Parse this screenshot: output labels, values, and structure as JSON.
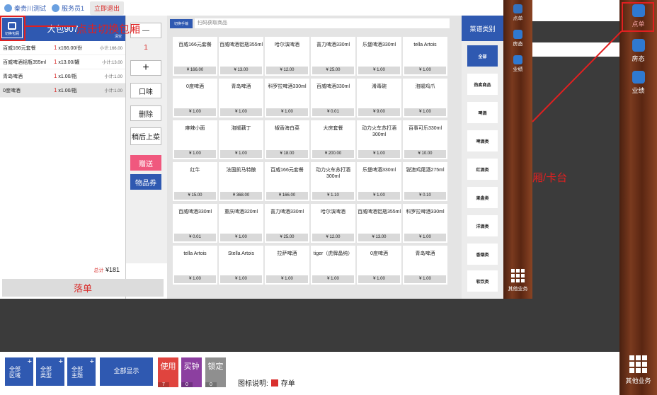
{
  "topbar": {
    "user1": "秦贵川测试",
    "user2": "服务员1",
    "logout": "立即退出"
  },
  "order": {
    "title": "大包907",
    "switch_label": "切换包厢",
    "empty_label": "清空",
    "items": [
      {
        "name": "百威166元套餐",
        "qty": "1",
        "unit": "x166.00/份",
        "sub": "小计:166.00"
      },
      {
        "name": "百威啤酒铝瓶355ml",
        "qty": "1",
        "unit": "x13.00/罐",
        "sub": "小计:13.00"
      },
      {
        "name": "青岛啤酒",
        "qty": "1",
        "unit": "x1.00/瓶",
        "sub": "小计:1.00"
      },
      {
        "name": "0度啤酒",
        "qty": "1",
        "unit": "x1.00/瓶",
        "sub": "小计:1.00"
      }
    ],
    "total_label": "总计",
    "total_value": "¥181",
    "drop_label": "落单"
  },
  "actions": {
    "minus": "—",
    "qty": "1",
    "plus": "+",
    "taste": "口味",
    "delete": "删除",
    "later": "稍后上菜",
    "gift": "赠送",
    "coupon": "物品券"
  },
  "menu": {
    "switch_label": "切换手输",
    "search_placeholder": "扫码获取商品",
    "items": [
      {
        "name": "百威166元套餐",
        "price": "¥ 166.00"
      },
      {
        "name": "百威啤酒铝瓶355ml",
        "price": "¥ 13.00"
      },
      {
        "name": "哈尔滨啤酒",
        "price": "¥ 12.00"
      },
      {
        "name": "喜力啤酒330ml",
        "price": "¥ 25.00"
      },
      {
        "name": "乐堡啤酒330ml",
        "price": "¥ 1.00"
      },
      {
        "name": "tella Artois",
        "price": "¥ 1.00"
      },
      {
        "name": "0度啤酒",
        "price": "¥ 1.00"
      },
      {
        "name": "青岛啤酒",
        "price": "¥ 1.00"
      },
      {
        "name": "科罗拉啤酒330ml",
        "price": "¥ 1.00"
      },
      {
        "name": "百威啤酒330ml",
        "price": "¥ 0.01"
      },
      {
        "name": "淆毒碗",
        "price": "¥ 9.00"
      },
      {
        "name": "泡椒鸡爪",
        "price": "¥ 1.00"
      },
      {
        "name": "麻辣小面",
        "price": "¥ 1.00"
      },
      {
        "name": "泡椒藕丁",
        "price": "¥ 1.00"
      },
      {
        "name": "椒香海白菜",
        "price": "¥ 18.00"
      },
      {
        "name": "大房套餐",
        "price": "¥ 200.00"
      },
      {
        "name": "动力火车苏打酒300ml",
        "price": "¥ 1.00"
      },
      {
        "name": "百事可乐330ml",
        "price": "¥ 10.00"
      },
      {
        "name": "红牛",
        "price": "¥ 15.00"
      },
      {
        "name": "法国凯马特酿",
        "price": "¥ 368.00"
      },
      {
        "name": "百威166元套餐",
        "price": "¥ 166.00"
      },
      {
        "name": "动力火车苏打酒300ml",
        "price": "¥ 1.10"
      },
      {
        "name": "乐堡啤酒330ml",
        "price": "¥ 1.00"
      },
      {
        "name": "锐澳鸡尾酒275ml",
        "price": "¥ 0.10"
      },
      {
        "name": "百威啤酒330ml",
        "price": "¥ 0.01"
      },
      {
        "name": "重庆啤酒320ml",
        "price": "¥ 1.00"
      },
      {
        "name": "喜力啤酒330ml",
        "price": "¥ 25.00"
      },
      {
        "name": "哈尔滨啤酒",
        "price": "¥ 12.00"
      },
      {
        "name": "百威啤酒铝瓶355ml",
        "price": "¥ 13.00"
      },
      {
        "name": "科罗拉啤酒330ml",
        "price": "¥ 1.00"
      },
      {
        "name": "tella Artois",
        "price": "¥ 1.00"
      },
      {
        "name": "Stella Artois",
        "price": "¥ 1.00"
      },
      {
        "name": "拉萨啤酒",
        "price": "¥ 1.00"
      },
      {
        "name": "tiger（虎牌晶纯）",
        "price": "¥ 1.00"
      },
      {
        "name": "0度啤酒",
        "price": "¥ 1.00"
      },
      {
        "name": "青岛啤酒",
        "price": "¥ 1.00"
      }
    ]
  },
  "categories": {
    "title": "菜谱类别",
    "items": [
      "全部",
      "热卖商品",
      "啤酒",
      "啤酒类",
      "红酒类",
      "果盘类",
      "洋酒类",
      "香烟类",
      "软饮类"
    ]
  },
  "inner_sidebar": {
    "items": [
      "点单",
      "房态",
      "业绩"
    ],
    "other": "其他业务"
  },
  "outer_sidebar": {
    "items": [
      "点单",
      "房态",
      "业绩"
    ],
    "other": "其他业务"
  },
  "bottom": {
    "btn_area": "全部\n区域",
    "btn_area_l1": "全部",
    "btn_area_l2": "区域",
    "btn_type_l1": "全部",
    "btn_type_l2": "类型",
    "btn_theme_l1": "全部",
    "btn_theme_l2": "主题",
    "show_all": "全部显示",
    "use": "使用",
    "use_cnt": "7",
    "buy": "买钟",
    "buy_cnt": "0",
    "lock": "锁定",
    "lock_cnt": "0",
    "legend_label": "图标说明:",
    "legend_item": "存单"
  },
  "annotations": {
    "click_switch": "点击切换包厢",
    "room_desk": "厢/卡台"
  },
  "colors": {
    "primary": "#2f59b1",
    "accent_red": "#d9302e",
    "gift_pink": "#f0587e",
    "annotation": "#e02020"
  }
}
